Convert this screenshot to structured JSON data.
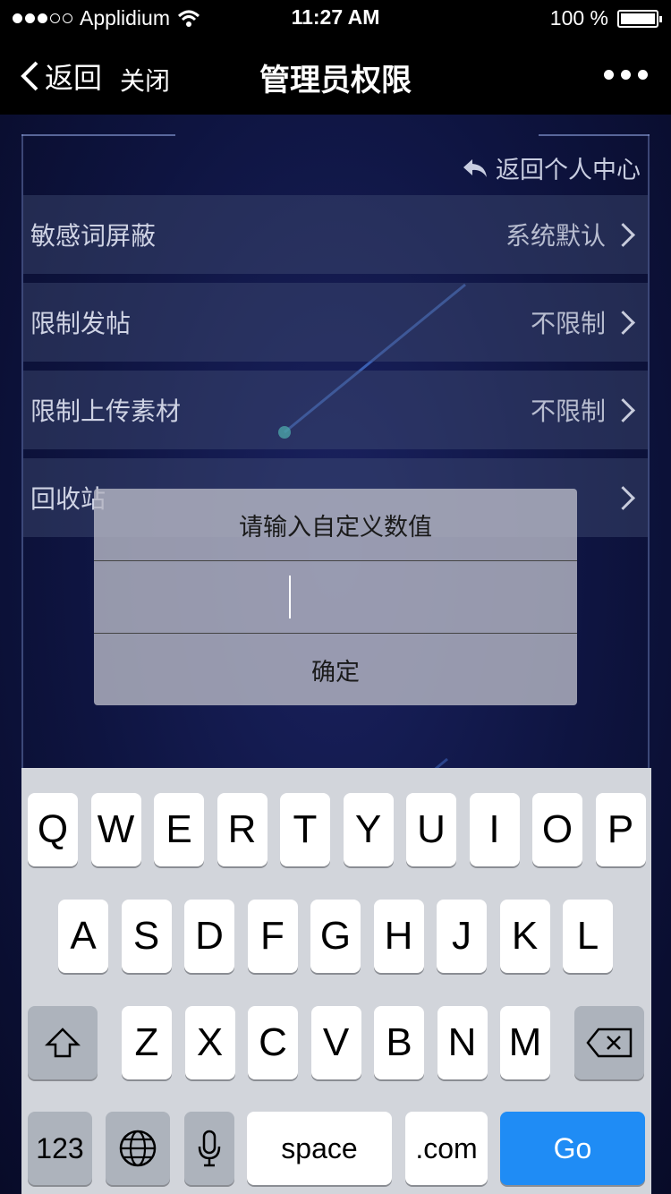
{
  "status": {
    "carrier": "Applidium",
    "time": "11:27 AM",
    "battery": "100 %"
  },
  "nav": {
    "back_label": "返回",
    "close_label": "关闭",
    "title": "管理员权限"
  },
  "page": {
    "back_to_center": "返回个人中心",
    "rows": [
      {
        "label": "敏感词屏蔽",
        "value": "系统默认"
      },
      {
        "label": "限制发帖",
        "value": "不限制"
      },
      {
        "label": "限制上传素材",
        "value": "不限制"
      },
      {
        "label": "回收站",
        "value": ""
      }
    ]
  },
  "dialog": {
    "title": "请输入自定义数值",
    "input_value": "",
    "confirm_label": "确定"
  },
  "keyboard": {
    "row1": [
      "Q",
      "W",
      "E",
      "R",
      "T",
      "Y",
      "U",
      "I",
      "O",
      "P"
    ],
    "row2": [
      "A",
      "S",
      "D",
      "F",
      "G",
      "H",
      "J",
      "K",
      "L"
    ],
    "row3": [
      "Z",
      "X",
      "C",
      "V",
      "B",
      "N",
      "M"
    ],
    "num_label": "123",
    "space_label": "space",
    "dotcom_label": ".com",
    "go_label": "Go"
  },
  "colors": {
    "go_key": "#1f8cf5",
    "nav_bg": "#000000",
    "page_bg": "#0e1440"
  }
}
